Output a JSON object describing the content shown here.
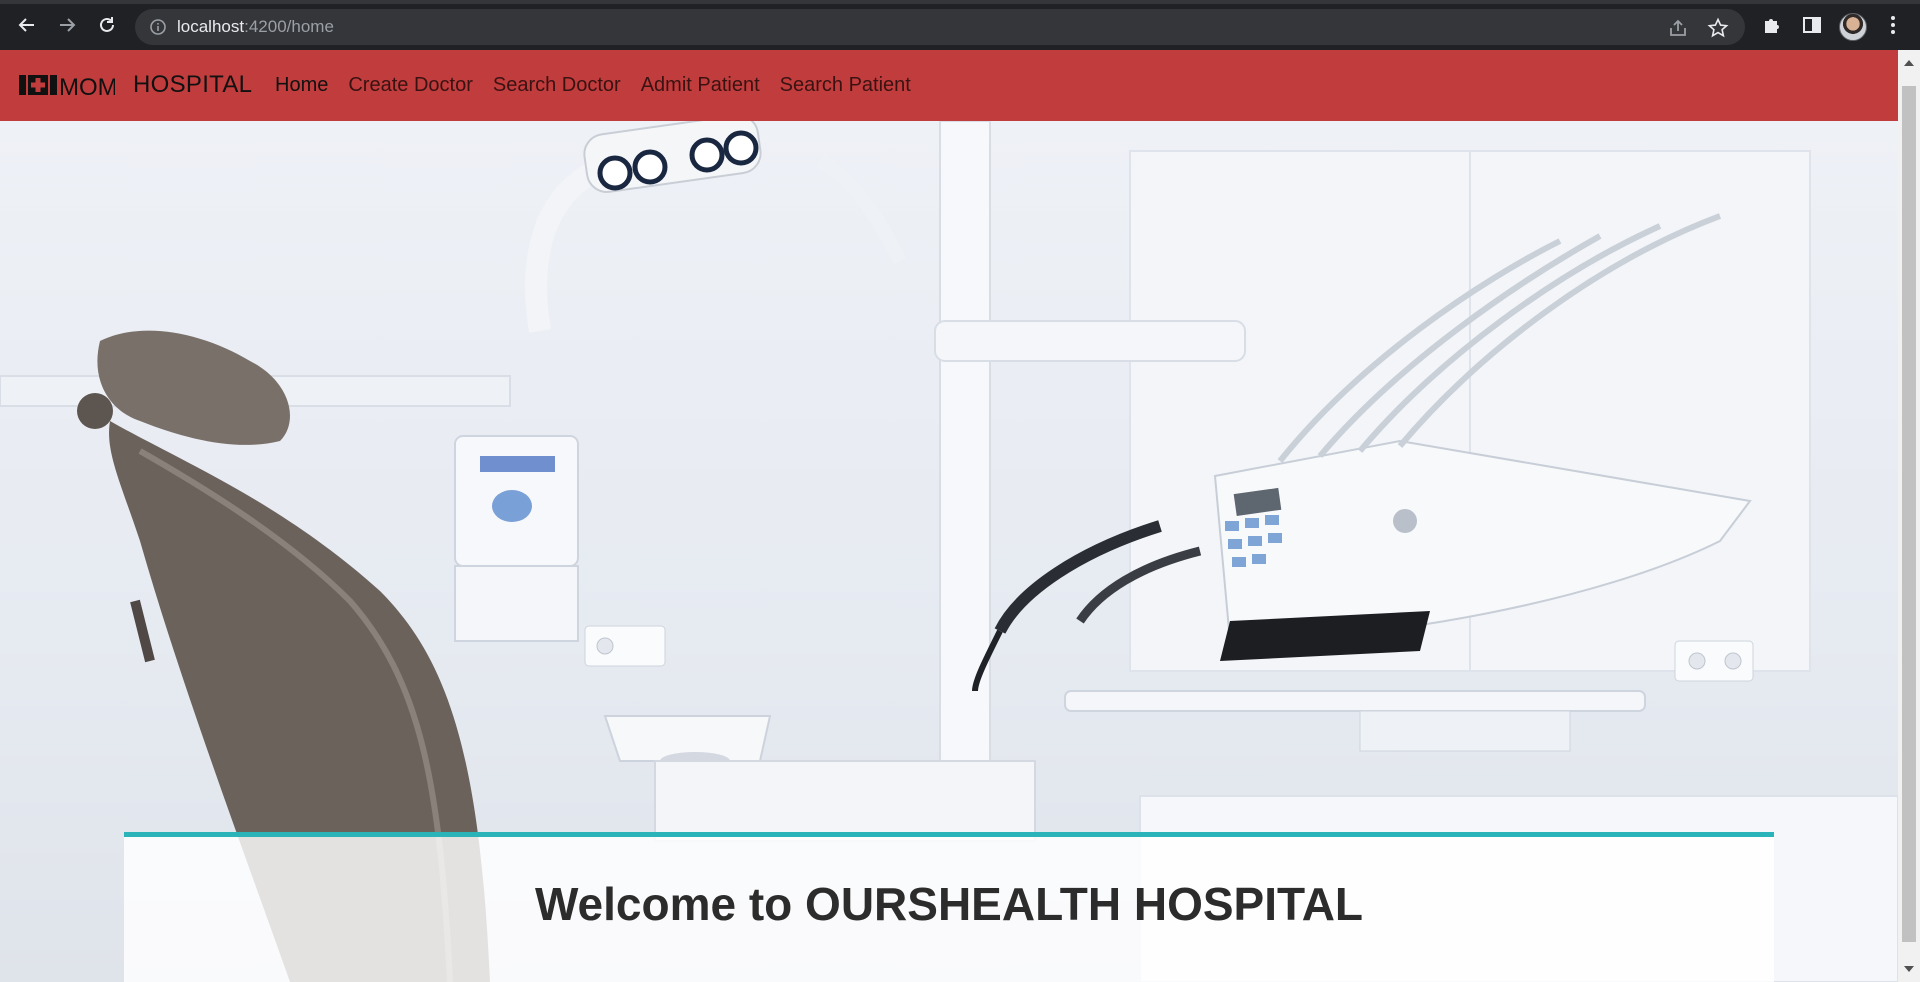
{
  "browser": {
    "url_host": "localhost",
    "url_path": ":4200/home"
  },
  "brand": {
    "logo_text": "MOM",
    "name": "HOSPITAL"
  },
  "nav": {
    "items": [
      {
        "label": "Home",
        "active": true
      },
      {
        "label": "Create Doctor",
        "active": false
      },
      {
        "label": "Search Doctor",
        "active": false
      },
      {
        "label": "Admit Patient",
        "active": false
      },
      {
        "label": "Search Patient",
        "active": false
      }
    ]
  },
  "hero": {
    "welcome_title": "Welcome to OURSHEALTH HOSPITAL"
  },
  "colors": {
    "navbar": "#c13c3c",
    "accent": "#2ab3b8",
    "chrome": "#202124"
  }
}
